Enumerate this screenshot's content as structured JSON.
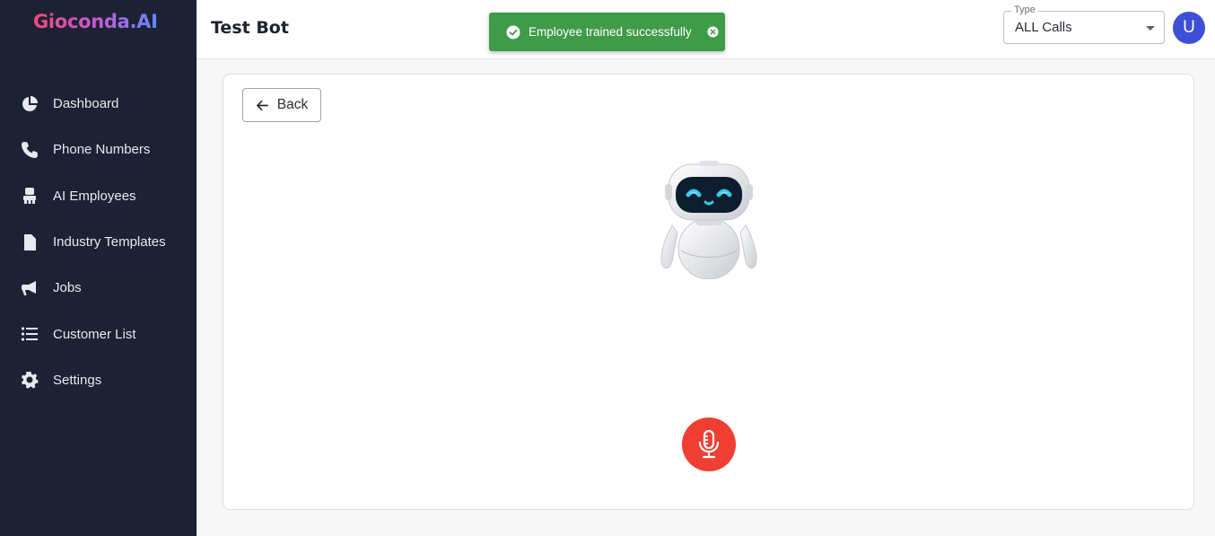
{
  "app": {
    "logo_text": "Gioconda.AI"
  },
  "sidebar": {
    "items": [
      {
        "label": "Dashboard",
        "icon": "pie-chart-icon"
      },
      {
        "label": "Phone Numbers",
        "icon": "phone-icon"
      },
      {
        "label": "AI Employees",
        "icon": "robot-employee-icon"
      },
      {
        "label": "Industry Templates",
        "icon": "file-icon"
      },
      {
        "label": "Jobs",
        "icon": "megaphone-icon"
      },
      {
        "label": "Customer List",
        "icon": "list-icon"
      },
      {
        "label": "Settings",
        "icon": "gear-icon"
      }
    ]
  },
  "header": {
    "title": "Test Bot",
    "type_select": {
      "legend": "Type",
      "value": "ALL Calls"
    },
    "avatar_initial": "U"
  },
  "toast": {
    "message": "Employee trained successfully",
    "status_color": "#3f9b47"
  },
  "main": {
    "back_label": "Back",
    "mic_color": "#ef3f33"
  }
}
